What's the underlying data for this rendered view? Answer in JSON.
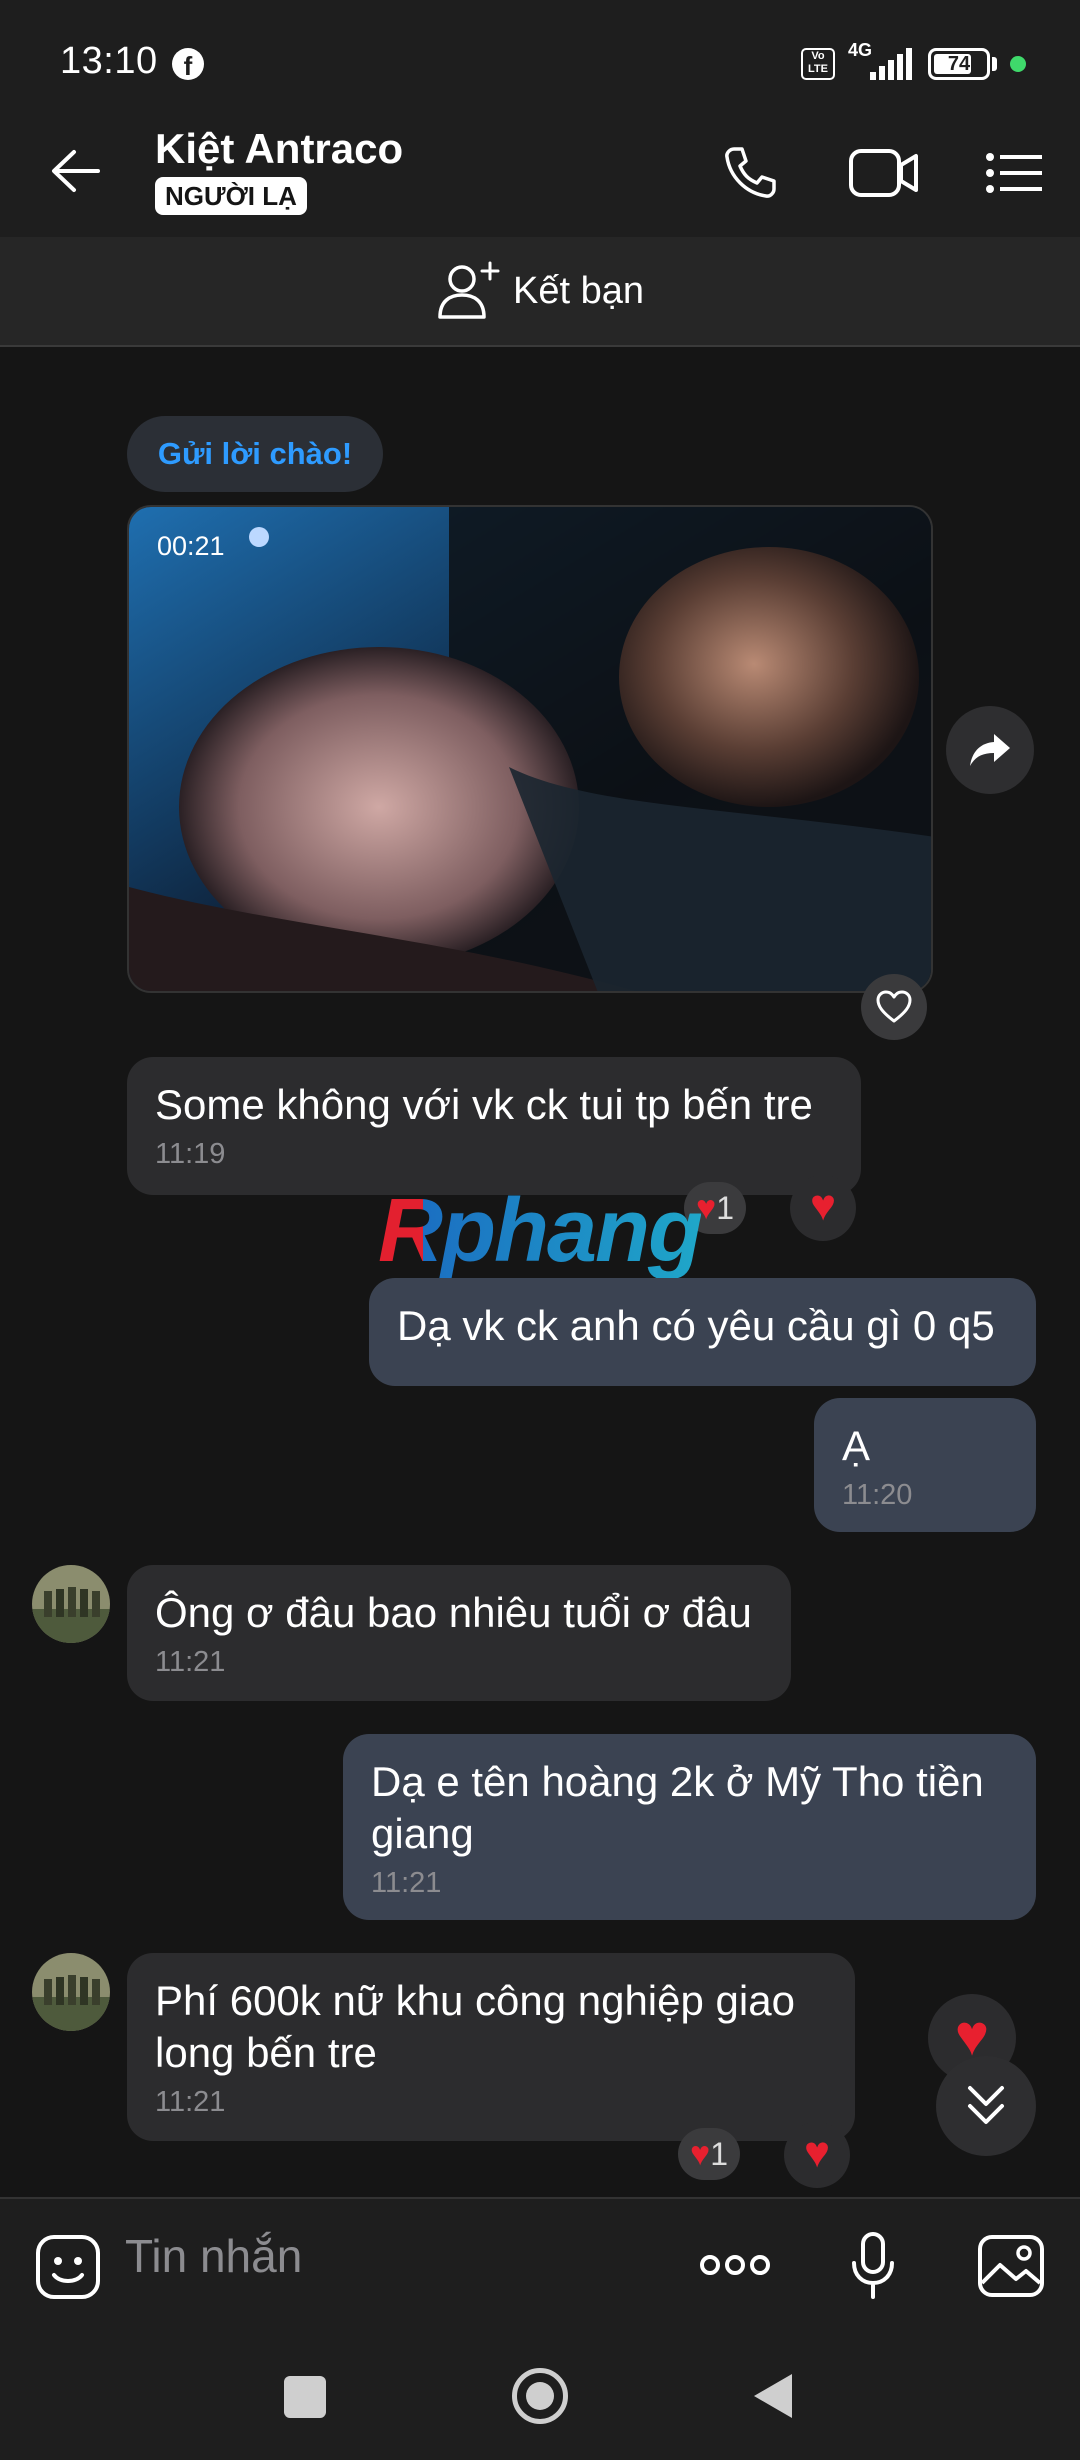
{
  "status_bar": {
    "time": "13:10",
    "volte": "Vo LTE",
    "network": "4G",
    "battery": "74",
    "battery_level": 0.74
  },
  "header": {
    "contact_name": "Kiệt Antraco",
    "badge": "NGƯỜI LẠ"
  },
  "friend_bar": {
    "label": "Kết bạn"
  },
  "chat": {
    "greet_button": "Gửi lời chào!",
    "video_duration": "00:21",
    "messages": [
      {
        "text": "Some không với vk ck tui tp bến tre",
        "time": "11:19",
        "reaction_count": "1"
      },
      {
        "text": "Dạ vk ck anh có yêu cầu gì 0 q5"
      },
      {
        "text": "Ạ",
        "time": "11:20"
      },
      {
        "text": "Ông ơ đâu bao nhiêu tuổi ơ đâu",
        "time": "11:21"
      },
      {
        "text": "Dạ e tên hoàng 2k ở Mỹ Tho tiền giang",
        "time": "11:21"
      },
      {
        "text": "Phí 600k nữ khu công nghiệp giao long bến tre",
        "time": "11:21",
        "reaction_count": "1"
      }
    ],
    "watermark": "Rphang"
  },
  "composer": {
    "placeholder": "Tin nhắn"
  },
  "colors": {
    "background": "#151515",
    "incoming_bubble": "#2c2c2e",
    "outgoing_bubble": "#3b4352",
    "link_blue": "#2e9bff",
    "heart_red": "#e8202f"
  }
}
